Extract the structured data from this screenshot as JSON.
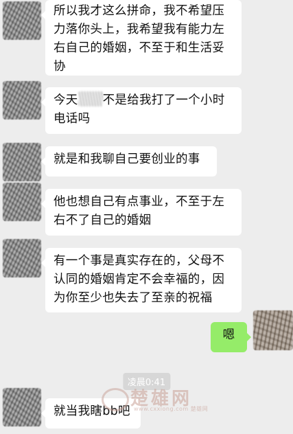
{
  "messages": [
    {
      "text": "所以我才这么拼命，我不希望压力落你头上，我希望我有能力左右自己的婚姻，不至于和生活妥协"
    },
    {
      "text_a": "今天",
      "text_b": "不是给我打了一个小时电话吗"
    },
    {
      "text": "就是和我聊自己要创业的事"
    },
    {
      "text": "他也想自己有点事业，不至于左右不了自己的婚姻"
    },
    {
      "text": "有一个事是真实存在的，父母不认同的婚姻肯定不会幸福的，因为你至少也失去了至亲的祝福"
    },
    {
      "text": "嗯"
    },
    {
      "text": "就当我瞎bb吧"
    }
  ],
  "timestamp": "凌晨0:41",
  "watermark": {
    "main": "楚雄网",
    "sub": "www.cxxiong.com 楚雄网"
  }
}
